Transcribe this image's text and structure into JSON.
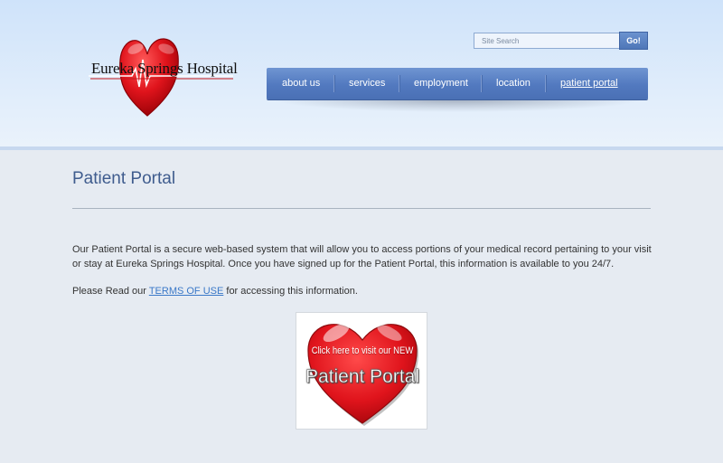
{
  "header": {
    "logo_text": "Eureka Springs Hospital",
    "search_placeholder": "Site Search",
    "search_button": "Go!"
  },
  "nav": {
    "items": [
      {
        "label": "about us"
      },
      {
        "label": "services"
      },
      {
        "label": "employment"
      },
      {
        "label": "location"
      },
      {
        "label": "patient portal",
        "active": true
      }
    ]
  },
  "main": {
    "title": "Patient Portal",
    "intro": "Our Patient Portal is a secure web-based system that will allow you to access portions of your medical record pertaining to your visit or stay at Eureka Springs Hospital. Once you have signed up for the Patient Portal, this information is available to you 24/7.",
    "read_prefix": "Please Read our ",
    "terms_link": "TERMS OF USE",
    "read_suffix": " for accessing this information.",
    "portal_card": {
      "small_text": "Click here to visit our NEW",
      "big_text": "Patient Portal"
    }
  },
  "colors": {
    "accent_blue": "#5279bf",
    "heart_red": "#e0141c",
    "title_blue": "#3f5c8e",
    "link_blue": "#3a78c8"
  },
  "icons": {
    "logo": "heart-ekg-icon",
    "portal": "heart-icon"
  }
}
